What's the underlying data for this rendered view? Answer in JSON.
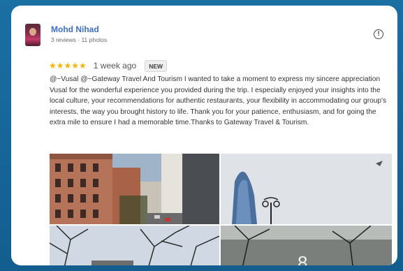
{
  "review": {
    "author_name": "Mohd Nihad",
    "author_meta": "3 reviews · 11 photos",
    "stars": "★★★★★",
    "time_ago": "1 week ago",
    "badge": "NEW",
    "text": "@~Vusal @~Gateway Travel And Tourism I wanted to take a moment to express my sincere appreciation Vusal for the wonderful experience you provided during the trip. I especially enjoyed your insights into the local culture, your recommendations for authentic restaurants, your flexibility in accommodating our group's interests, the way you brought history to life. Thank you for your patience, enthusiasm, and for going the extra mile to ensure I had a memorable time.Thanks to Gateway Travel & Tourism."
  },
  "icons": {
    "info": "info-icon",
    "star": "star-icon"
  },
  "colors": {
    "background": "#1a6fa3",
    "author_link": "#3b6fc8",
    "star": "#f6b400"
  }
}
